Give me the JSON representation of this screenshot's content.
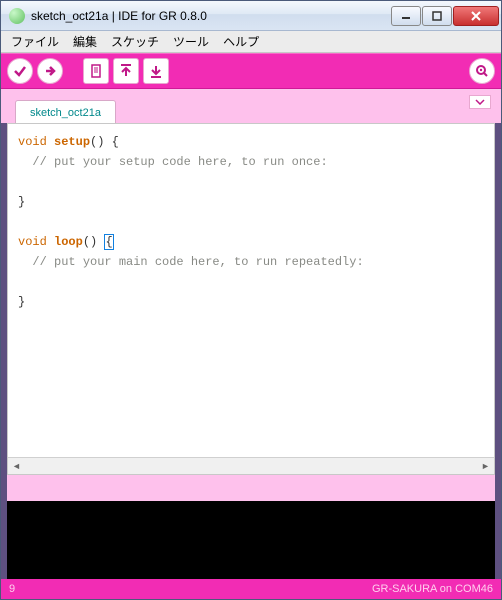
{
  "window": {
    "title": "sketch_oct21a | IDE for GR 0.8.0"
  },
  "menubar": {
    "file": "ファイル",
    "edit": "編集",
    "sketch": "スケッチ",
    "tools": "ツール",
    "help": "ヘルプ"
  },
  "tab": {
    "name": "sketch_oct21a"
  },
  "code": {
    "l1_kw": "void",
    "l1_fn": "setup",
    "l1_tail": "() {",
    "l2_cm": "// put your setup code here, to run once:",
    "l3_blank": "",
    "l4_close": "}",
    "l5_blank": "",
    "l6_kw": "void",
    "l6_fn": "loop",
    "l6_paren": "() ",
    "l6_brace": "{",
    "l7_cm": "// put your main code here, to run repeatedly:",
    "l8_blank": "",
    "l9_close": "}"
  },
  "status": {
    "line": "9",
    "board": "GR-SAKURA on COM46"
  }
}
